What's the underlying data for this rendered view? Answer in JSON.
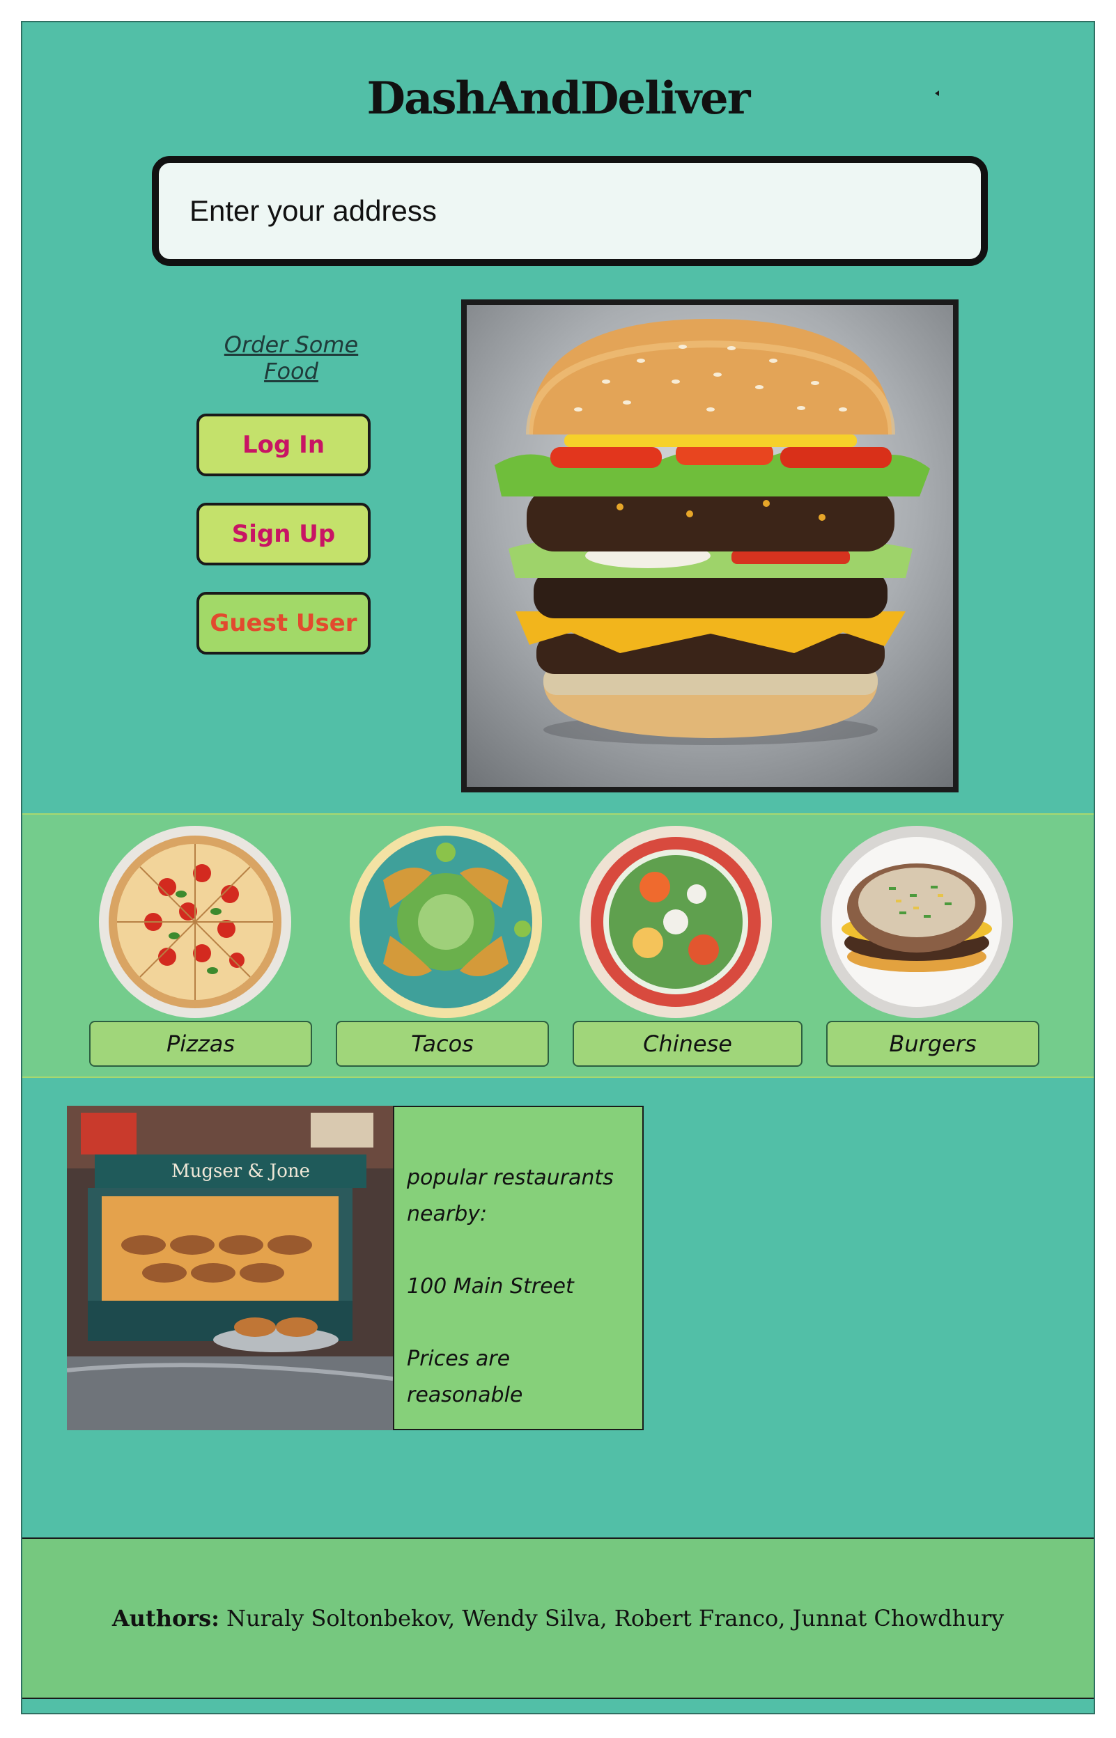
{
  "header": {
    "title": "DashAndDeliver"
  },
  "search": {
    "placeholder": "Enter your address"
  },
  "hero": {
    "order_link": "Order Some Food",
    "buttons": {
      "login": "Log In",
      "signup": "Sign Up",
      "guest": "Guest User"
    }
  },
  "categories": [
    {
      "label": "Pizzas"
    },
    {
      "label": "Tacos"
    },
    {
      "label": "Chinese"
    },
    {
      "label": "Burgers"
    }
  ],
  "restaurant": {
    "sign_text": "Mugser & Jone",
    "lines": [
      "popular restaurants",
      "nearby:",
      "100 Main Street",
      "Prices are reasonable"
    ]
  },
  "footer": {
    "label": "Authors:",
    "names": "Nuraly Soltonbekov, Wendy Silva, Robert Franco, Junnat Chowdhury"
  },
  "colors": {
    "page_background": "#52bfa7",
    "category_band": "#74cc8c",
    "button_fill": "#c4e16b",
    "button_text": "#c81464",
    "guest_text": "#e24a2e",
    "info_panel": "#86d07a",
    "footer": "#76c87f"
  }
}
